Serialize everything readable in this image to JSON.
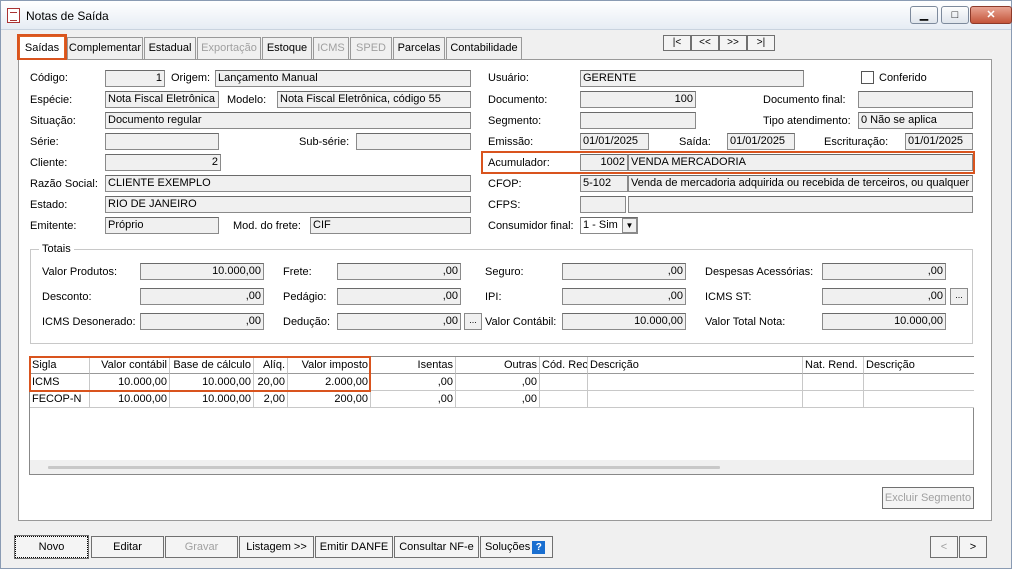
{
  "window": {
    "title": "Notas de Saída"
  },
  "tabs": [
    "Saídas",
    "Complementar",
    "Estadual",
    "Exportação",
    "Estoque",
    "ICMS",
    "SPED",
    "Parcelas",
    "Contabilidade"
  ],
  "nav": [
    "|<",
    "<<",
    ">>",
    ">|"
  ],
  "form": {
    "codigo_label": "Código:",
    "codigo": "1",
    "origem_label": "Origem:",
    "origem": "Lançamento Manual",
    "especie_label": "Espécie:",
    "especie": "Nota Fiscal Eletrônica",
    "modelo_label": "Modelo:",
    "modelo": "Nota Fiscal Eletrônica, código 55",
    "situacao_label": "Situação:",
    "situacao": "Documento regular",
    "serie_label": "Série:",
    "serie": "",
    "subserie_label": "Sub-série:",
    "subserie": "",
    "cliente_label": "Cliente:",
    "cliente": "2",
    "razao_label": "Razão Social:",
    "razao": "CLIENTE EXEMPLO",
    "estado_label": "Estado:",
    "estado": "RIO DE JANEIRO",
    "emitente_label": "Emitente:",
    "emitente": "Próprio",
    "frete_label": "Mod. do frete:",
    "frete": "CIF",
    "usuario_label": "Usuário:",
    "usuario": "GERENTE",
    "conferido_label": "Conferido",
    "documento_label": "Documento:",
    "documento": "100",
    "docfinal_label": "Documento final:",
    "docfinal": "",
    "segmento_label": "Segmento:",
    "segmento": "",
    "tipoatend_label": "Tipo atendimento:",
    "tipoatend": "0 Não se aplica",
    "emissao_label": "Emissão:",
    "emissao": "01/01/2025",
    "saida_label": "Saída:",
    "saida": "01/01/2025",
    "escrit_label": "Escrituração:",
    "escrit": "01/01/2025",
    "acumulador_label": "Acumulador:",
    "acumulador_code": "1002",
    "acumulador_desc": "VENDA MERCADORIA",
    "cfop_label": "CFOP:",
    "cfop_code": "5-102",
    "cfop_desc": "Venda de mercadoria adquirida ou recebida de terceiros, ou qualquer ve",
    "cfps_label": "CFPS:",
    "cfps_code": "",
    "cfps_desc": "",
    "consumidor_label": "Consumidor final:",
    "consumidor": "1 - Sim"
  },
  "totais": {
    "group_label": "Totais",
    "valor_produtos_label": "Valor Produtos:",
    "valor_produtos": "10.000,00",
    "frete_label": "Frete:",
    "frete": ",00",
    "seguro_label": "Seguro:",
    "seguro": ",00",
    "despesas_label": "Despesas Acessórias:",
    "despesas": ",00",
    "desconto_label": "Desconto:",
    "desconto": ",00",
    "pedagio_label": "Pedágio:",
    "pedagio": ",00",
    "ipi_label": "IPI:",
    "ipi": ",00",
    "icms_st_label": "ICMS ST:",
    "icms_st": ",00",
    "icms_deson_label": "ICMS Desonerado:",
    "icms_deson": ",00",
    "deducao_label": "Dedução:",
    "deducao": ",00",
    "valor_contabil_label": "Valor Contábil:",
    "valor_contabil": "10.000,00",
    "valor_total_label": "Valor Total Nota:",
    "valor_total": "10.000,00",
    "ellipsis": "..."
  },
  "grid": {
    "headers": [
      "Sigla",
      "Valor contábil",
      "Base de cálculo",
      "Alíq.",
      "Valor imposto",
      "Isentas",
      "Outras",
      "Cód. Rec.",
      "Descrição",
      "Nat. Rend.",
      "Descrição"
    ],
    "rows": [
      [
        "ICMS",
        "10.000,00",
        "10.000,00",
        "20,00",
        "2.000,00",
        ",00",
        ",00",
        "",
        "",
        "",
        ""
      ],
      [
        "FECOP-N",
        "10.000,00",
        "10.000,00",
        "2,00",
        "200,00",
        ",00",
        ",00",
        "",
        "",
        "",
        ""
      ]
    ]
  },
  "excluir_segmento": "Excluir Segmento",
  "buttons": {
    "novo": "Novo",
    "editar": "Editar",
    "gravar": "Gravar",
    "listagem": "Listagem >>",
    "emitir": "Emitir DANFE",
    "consultar": "Consultar NF-e",
    "solucoes": "Soluções",
    "prev": "<",
    "next": ">"
  },
  "colors": {
    "highlight": "#d9541e"
  }
}
